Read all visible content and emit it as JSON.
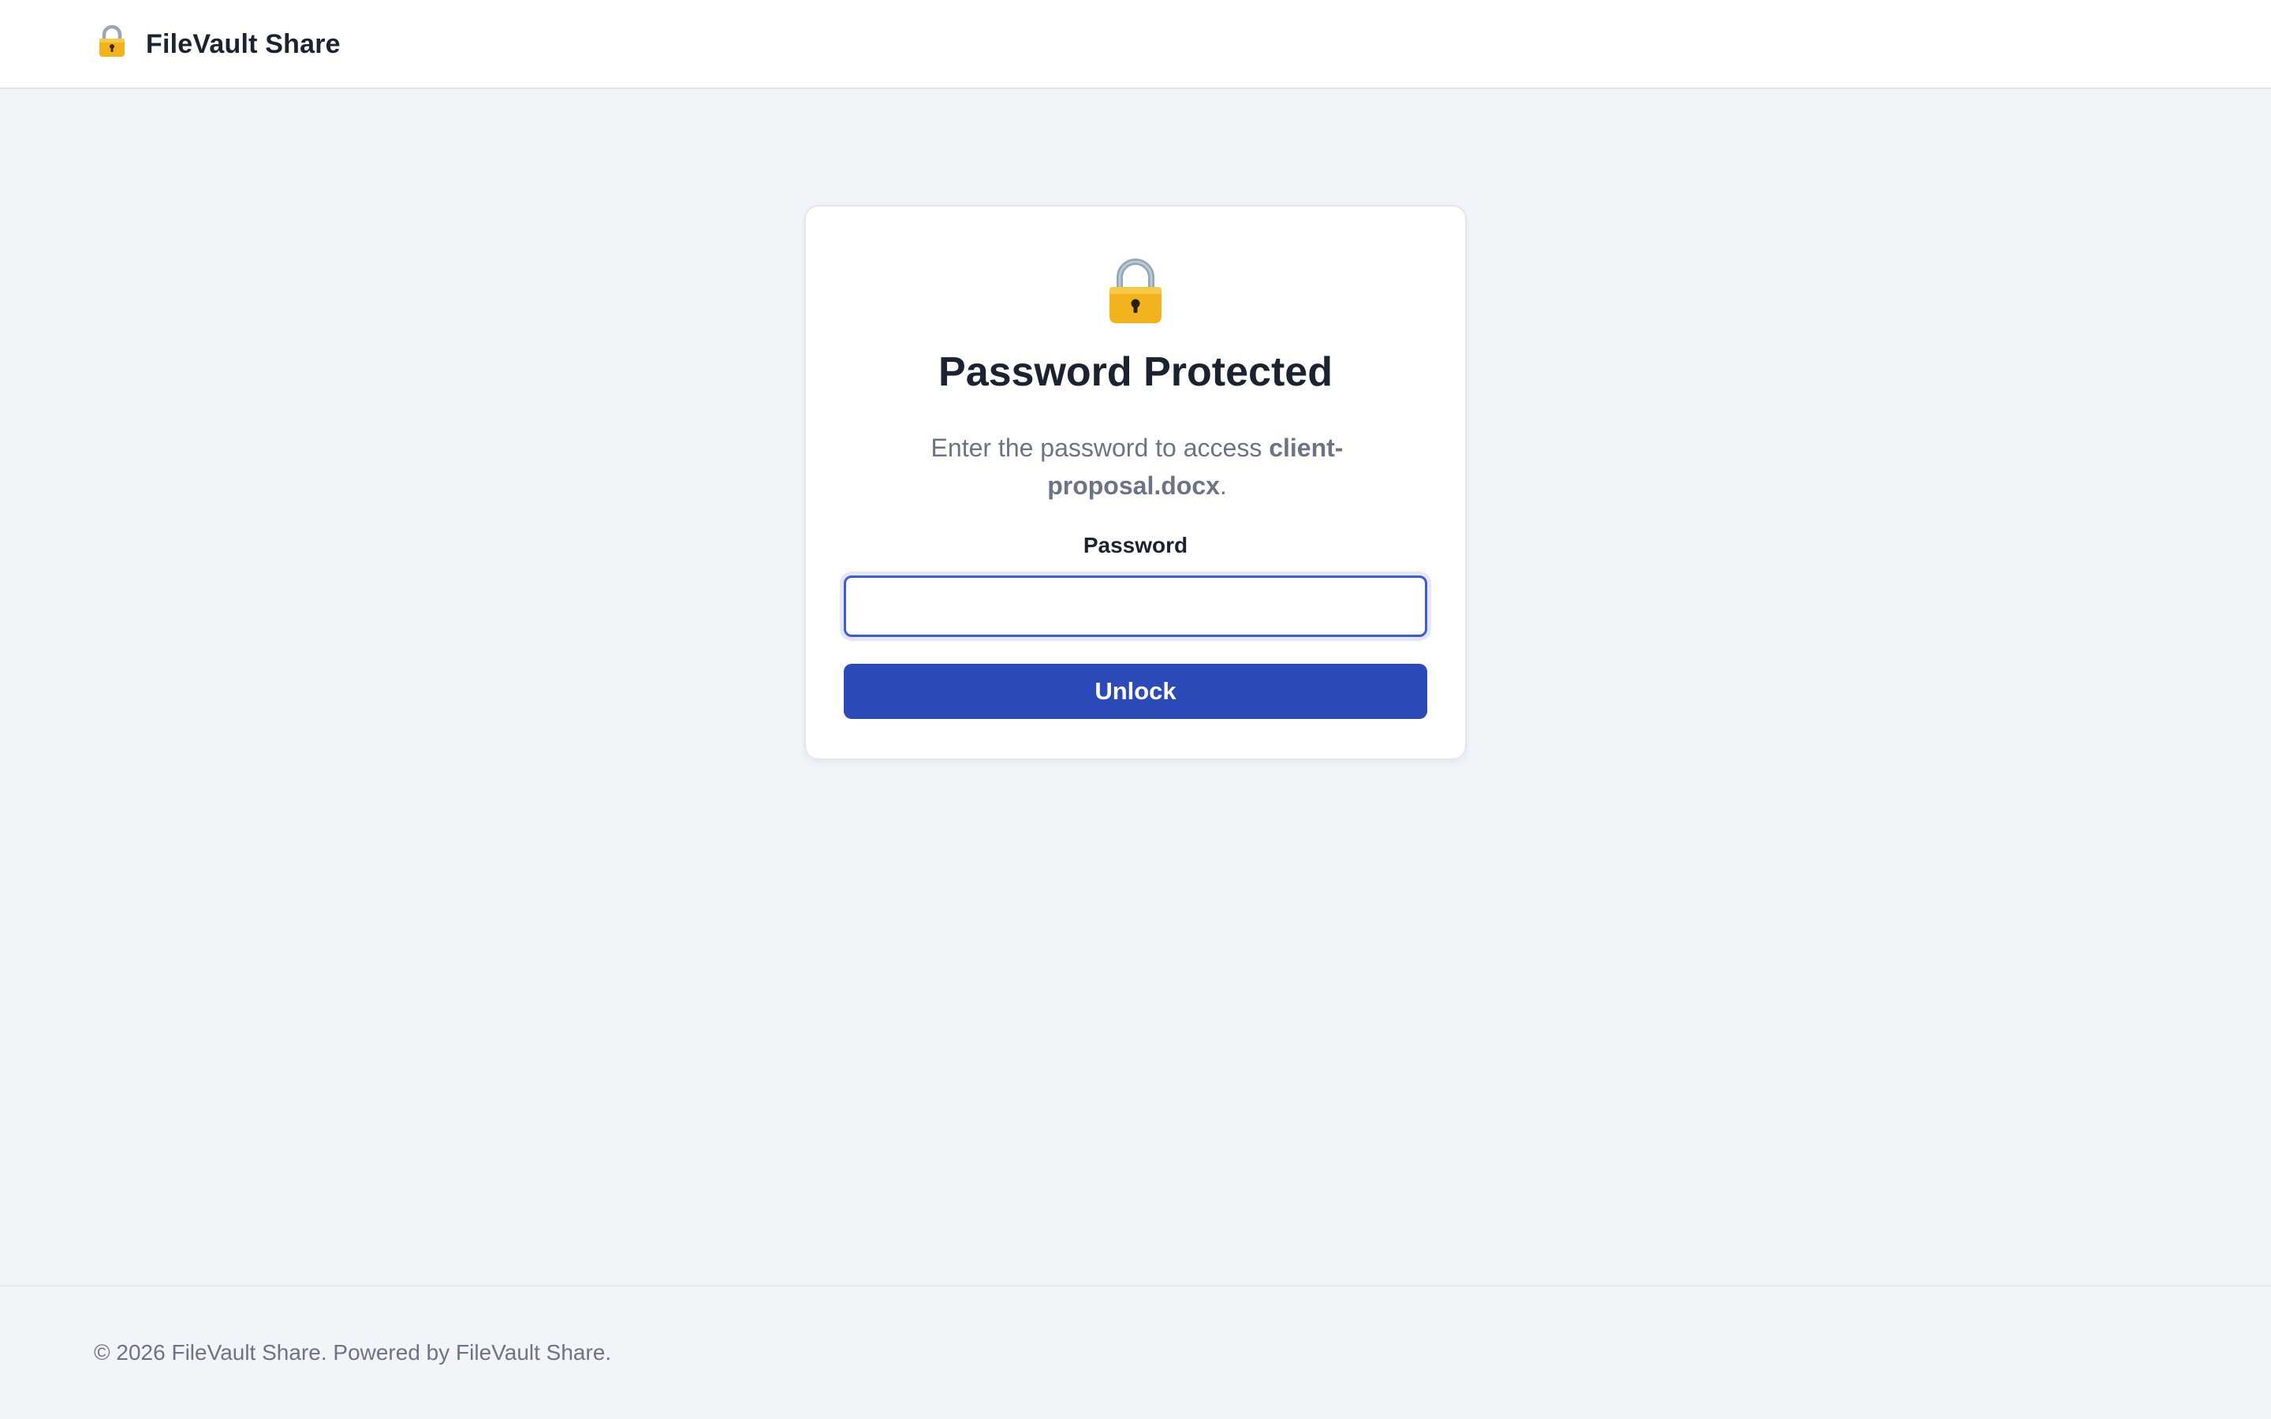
{
  "header": {
    "brand_name": "FileVault Share",
    "brand_icon": "lock-icon"
  },
  "card": {
    "icon": "lock-icon",
    "title": "Password Protected",
    "description_prefix": "Enter the password to access ",
    "file_name": "client-proposal.docx",
    "description_suffix": ".",
    "password_label": "Password",
    "password_value": "",
    "password_placeholder": "",
    "unlock_label": "Unlock"
  },
  "footer": {
    "text": "© 2026 FileVault Share. Powered by FileVault Share."
  },
  "colors": {
    "accent": "#2c4ab8",
    "focus_ring": "#3b5bdb",
    "background": "#f3f4f8",
    "text_primary": "#1b2230",
    "text_muted": "#6b7485"
  }
}
